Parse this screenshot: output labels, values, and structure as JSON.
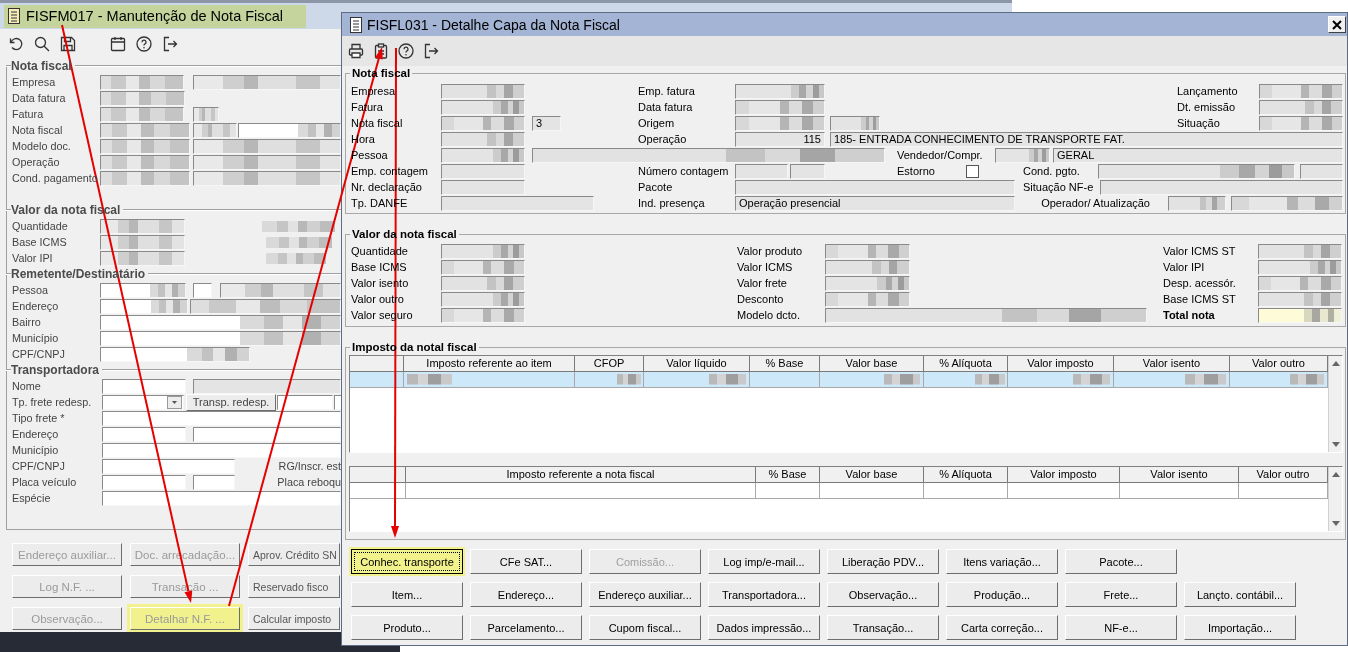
{
  "back_window": {
    "title": "FISFM017 - Manutenção de Nota Fiscal",
    "title_highlighted": true,
    "sections": [
      {
        "title": "Nota fiscal",
        "rows": [
          {
            "items": [
              {
                "kind": "label",
                "text": "Empresa"
              },
              {
                "kind": "redacted"
              },
              {
                "kind": "redacted"
              }
            ]
          },
          {
            "items": [
              {
                "kind": "label",
                "text": "Data fatura"
              },
              {
                "kind": "redacted"
              }
            ]
          },
          {
            "items": [
              {
                "kind": "label",
                "text": "Fatura"
              },
              {
                "kind": "redacted"
              },
              {
                "kind": "redacted"
              }
            ]
          },
          {
            "items": [
              {
                "kind": "label",
                "text": "Nota fiscal"
              },
              {
                "kind": "redacted"
              },
              {
                "kind": "redacted"
              },
              {
                "kind": "redacted"
              }
            ]
          },
          {
            "items": [
              {
                "kind": "label",
                "text": "Modelo doc."
              },
              {
                "kind": "redacted"
              },
              {
                "kind": "redacted"
              }
            ]
          },
          {
            "items": [
              {
                "kind": "label",
                "text": "Operação"
              },
              {
                "kind": "redacted"
              },
              {
                "kind": "redacted"
              }
            ]
          },
          {
            "items": [
              {
                "kind": "label",
                "text": "Cond. pagamento"
              },
              {
                "kind": "redacted"
              },
              {
                "kind": "redacted"
              }
            ]
          }
        ]
      },
      {
        "title": "Valor da nota fiscal",
        "rows": [
          {
            "items": [
              {
                "kind": "label",
                "text": "Quantidade"
              },
              {
                "kind": "redacted"
              },
              {
                "kind": "blot"
              }
            ]
          },
          {
            "items": [
              {
                "kind": "label",
                "text": "Base ICMS"
              },
              {
                "kind": "redacted"
              },
              {
                "kind": "blot"
              }
            ]
          },
          {
            "items": [
              {
                "kind": "label",
                "text": "Valor IPI"
              },
              {
                "kind": "redacted"
              },
              {
                "kind": "blot"
              }
            ]
          }
        ]
      },
      {
        "title": "Remetente/Destinatário",
        "rows": [
          {
            "items": [
              {
                "kind": "label",
                "text": "Pessoa"
              },
              {
                "kind": "redacted"
              },
              {
                "kind": "field"
              },
              {
                "kind": "redacted"
              }
            ]
          },
          {
            "items": [
              {
                "kind": "label",
                "text": "Endereço"
              },
              {
                "kind": "redacted"
              },
              {
                "kind": "redacted"
              }
            ]
          },
          {
            "items": [
              {
                "kind": "label",
                "text": "Bairro"
              },
              {
                "kind": "redacted"
              }
            ]
          },
          {
            "items": [
              {
                "kind": "label",
                "text": "Município"
              },
              {
                "kind": "redacted"
              }
            ]
          },
          {
            "items": [
              {
                "kind": "label",
                "text": "CPF/CNPJ"
              },
              {
                "kind": "redacted"
              }
            ]
          }
        ]
      },
      {
        "title": "Transportadora",
        "rows": [
          {
            "items": [
              {
                "kind": "label",
                "text": "Nome"
              },
              {
                "kind": "field"
              },
              {
                "kind": "readonly"
              }
            ]
          },
          {
            "items": [
              {
                "kind": "label",
                "text": "Tp. frete redesp."
              },
              {
                "kind": "dropdown"
              },
              {
                "kind": "button",
                "text": "Transp. redesp."
              },
              {
                "kind": "field"
              },
              {
                "kind": "field"
              }
            ]
          },
          {
            "items": [
              {
                "kind": "label",
                "text": "Tipo frete *"
              },
              {
                "kind": "field"
              }
            ]
          },
          {
            "items": [
              {
                "kind": "label",
                "text": "Endereço"
              },
              {
                "kind": "field"
              },
              {
                "kind": "field"
              }
            ]
          },
          {
            "items": [
              {
                "kind": "label",
                "text": "Município"
              },
              {
                "kind": "field"
              }
            ]
          },
          {
            "items": [
              {
                "kind": "label",
                "text": "CPF/CNPJ"
              },
              {
                "kind": "field"
              },
              {
                "kind": "label",
                "text": "RG/Inscr. est"
              }
            ]
          },
          {
            "items": [
              {
                "kind": "label",
                "text": "Placa veículo"
              },
              {
                "kind": "field"
              },
              {
                "kind": "field"
              },
              {
                "kind": "label",
                "text": "Placa reboqu"
              }
            ]
          },
          {
            "items": [
              {
                "kind": "label",
                "text": "Espécie"
              },
              {
                "kind": "field"
              }
            ]
          }
        ]
      }
    ],
    "buttons": [
      {
        "label": "Endereço auxiliar...",
        "disabled": true,
        "highlighted": false
      },
      {
        "label": "Doc. arrecadação...",
        "disabled": true,
        "highlighted": false
      },
      {
        "label": "Aprov. Crédito SN",
        "disabled": false,
        "highlighted": false
      },
      {
        "label": "Log N.F. ...",
        "disabled": true,
        "highlighted": false
      },
      {
        "label": "Transação ...",
        "disabled": true,
        "highlighted": false
      },
      {
        "label": "Reservado fisco",
        "disabled": false,
        "highlighted": false
      },
      {
        "label": "Observação...",
        "disabled": true,
        "highlighted": false
      },
      {
        "label": "Detalhar N.F. ...",
        "disabled": true,
        "highlighted": true
      },
      {
        "label": "Calcular imposto",
        "disabled": false,
        "highlighted": false
      }
    ]
  },
  "dialog": {
    "title": "FISFL031 - Detalhe Capa da Nota Fiscal",
    "groups": [
      {
        "title": "Nota fiscal",
        "rows": [
          {
            "items": [
              {
                "kind": "label",
                "text": "Empresa"
              },
              {
                "kind": "redacted"
              },
              {
                "kind": "label",
                "text": "Emp. fatura"
              },
              {
                "kind": "redacted"
              },
              {
                "kind": "label",
                "text": "Lançamento"
              },
              {
                "kind": "redacted"
              }
            ]
          },
          {
            "items": [
              {
                "kind": "label",
                "text": "Fatura"
              },
              {
                "kind": "redacted"
              },
              {
                "kind": "label",
                "text": "Data fatura"
              },
              {
                "kind": "redacted"
              },
              {
                "kind": "label",
                "text": "Dt. emissão"
              },
              {
                "kind": "redacted"
              }
            ]
          },
          {
            "items": [
              {
                "kind": "label",
                "text": "Nota fiscal"
              },
              {
                "kind": "redacted"
              },
              {
                "kind": "readonly",
                "value": "3"
              },
              {
                "kind": "label",
                "text": "Origem"
              },
              {
                "kind": "redacted"
              },
              {
                "kind": "redacted"
              },
              {
                "kind": "label",
                "text": "Situação"
              },
              {
                "kind": "redacted"
              }
            ]
          },
          {
            "items": [
              {
                "kind": "label",
                "text": "Hora"
              },
              {
                "kind": "redacted"
              },
              {
                "kind": "label",
                "text": "Operação"
              },
              {
                "kind": "readonly",
                "value": "115"
              },
              {
                "kind": "readonly",
                "value": "185- ENTRADA CONHECIMENTO DE TRANSPORTE FAT."
              }
            ]
          },
          {
            "items": [
              {
                "kind": "label",
                "text": "Pessoa"
              },
              {
                "kind": "redacted"
              },
              {
                "kind": "redacted"
              },
              {
                "kind": "label",
                "text": "Vendedor/Compr."
              },
              {
                "kind": "redacted"
              },
              {
                "kind": "readonly",
                "value": "GERAL"
              }
            ]
          },
          {
            "items": [
              {
                "kind": "label",
                "text": "Emp. contagem"
              },
              {
                "kind": "readonly"
              },
              {
                "kind": "label",
                "text": "Número contagem"
              },
              {
                "kind": "readonly"
              },
              {
                "kind": "readonly"
              },
              {
                "kind": "label",
                "text": "Estorno"
              },
              {
                "kind": "checkbox",
                "checked": false
              },
              {
                "kind": "label",
                "text": "Cond. pgto."
              },
              {
                "kind": "redacted"
              },
              {
                "kind": "readonly"
              }
            ]
          },
          {
            "items": [
              {
                "kind": "label",
                "text": "Nr. declaração"
              },
              {
                "kind": "readonly"
              },
              {
                "kind": "label",
                "text": "Pacote"
              },
              {
                "kind": "readonly"
              },
              {
                "kind": "label",
                "text": "Situação NF-e"
              },
              {
                "kind": "readonly"
              }
            ]
          },
          {
            "items": [
              {
                "kind": "label",
                "text": "Tp. DANFE"
              },
              {
                "kind": "readonly"
              },
              {
                "kind": "label",
                "text": "Ind. presença"
              },
              {
                "kind": "readonly",
                "value": "Operação presencial"
              },
              {
                "kind": "label",
                "text": "Operador/ Atualização"
              },
              {
                "kind": "redacted"
              },
              {
                "kind": "redacted"
              }
            ]
          }
        ]
      },
      {
        "title": "Valor da nota fiscal",
        "rows": [
          {
            "items": [
              {
                "kind": "label",
                "text": "Quantidade"
              },
              {
                "kind": "redacted"
              },
              {
                "kind": "label",
                "text": "Valor produto"
              },
              {
                "kind": "redacted"
              },
              {
                "kind": "label",
                "text": "Valor ICMS ST"
              },
              {
                "kind": "redacted"
              }
            ]
          },
          {
            "items": [
              {
                "kind": "label",
                "text": "Base ICMS"
              },
              {
                "kind": "redacted"
              },
              {
                "kind": "label",
                "text": "Valor ICMS"
              },
              {
                "kind": "redacted"
              },
              {
                "kind": "label",
                "text": "Valor IPI"
              },
              {
                "kind": "redacted"
              }
            ]
          },
          {
            "items": [
              {
                "kind": "label",
                "text": "Valor isento"
              },
              {
                "kind": "redacted"
              },
              {
                "kind": "label",
                "text": "Valor frete"
              },
              {
                "kind": "redacted"
              },
              {
                "kind": "label",
                "text": "Desp. acessór."
              },
              {
                "kind": "redacted"
              }
            ]
          },
          {
            "items": [
              {
                "kind": "label",
                "text": "Valor outro"
              },
              {
                "kind": "redacted"
              },
              {
                "kind": "label",
                "text": "Desconto"
              },
              {
                "kind": "redacted"
              },
              {
                "kind": "label",
                "text": "Base ICMS ST"
              },
              {
                "kind": "redacted"
              }
            ]
          },
          {
            "items": [
              {
                "kind": "label",
                "text": "Valor seguro"
              },
              {
                "kind": "redacted"
              },
              {
                "kind": "label",
                "text": "Modelo dcto."
              },
              {
                "kind": "redacted"
              },
              {
                "kind": "strong-label",
                "text": "Total nota"
              },
              {
                "kind": "total"
              }
            ]
          }
        ]
      }
    ],
    "tax_group": {
      "title": "Imposto da notal fiscal",
      "tables": [
        {
          "columns": [
            {
              "label": "Imposto referente ao item"
            },
            {
              "label": "CFOP"
            },
            {
              "label": "Valor líquido"
            },
            {
              "label": "% Base"
            },
            {
              "label": "Valor base"
            },
            {
              "label": "% Alíquota"
            },
            {
              "label": "Valor imposto"
            },
            {
              "label": "Valor isento"
            },
            {
              "label": "Valor outro"
            }
          ],
          "rows": [
            {
              "selected": true,
              "cells": [
                {
                  "redacted": true
                },
                {
                  "redacted": true
                },
                {
                  "redacted": true
                },
                {
                  "redacted": false
                },
                {
                  "redacted": true
                },
                {
                  "redacted": true
                },
                {
                  "redacted": true
                },
                {
                  "redacted": true
                },
                {
                  "redacted": true
                }
              ]
            }
          ]
        },
        {
          "columns": [
            {
              "label": "Imposto referente a nota fiscal"
            },
            {
              "label": "% Base"
            },
            {
              "label": "Valor base"
            },
            {
              "label": "% Alíquota"
            },
            {
              "label": "Valor imposto"
            },
            {
              "label": "Valor isento"
            },
            {
              "label": "Valor outro"
            }
          ],
          "rows": [
            {
              "selected": false,
              "cells": [
                {
                  "redacted": false
                },
                {
                  "redacted": false
                },
                {
                  "redacted": false
                },
                {
                  "redacted": false
                },
                {
                  "redacted": false
                },
                {
                  "redacted": false
                },
                {
                  "redacted": false
                }
              ]
            }
          ]
        }
      ]
    },
    "button_rows": [
      {
        "buttons": [
          {
            "label": "Conhec. transporte",
            "highlighted": true,
            "focused": true,
            "disabled": false
          },
          {
            "label": "CFe SAT...",
            "highlighted": false,
            "focused": false,
            "disabled": false
          },
          {
            "label": "Comissão...",
            "highlighted": false,
            "focused": false,
            "disabled": true
          },
          {
            "label": "Log imp/e-mail...",
            "highlighted": false,
            "focused": false,
            "disabled": false
          },
          {
            "label": "Liberação PDV...",
            "highlighted": false,
            "focused": false,
            "disabled": false
          },
          {
            "label": "Itens variação...",
            "highlighted": false,
            "focused": false,
            "disabled": false
          },
          {
            "label": "Pacote...",
            "highlighted": false,
            "focused": false,
            "disabled": false
          }
        ]
      },
      {
        "buttons": [
          {
            "label": "Item...",
            "highlighted": false,
            "focused": false,
            "disabled": false
          },
          {
            "label": "Endereço...",
            "highlighted": false,
            "focused": false,
            "disabled": false
          },
          {
            "label": "Endereço auxiliar...",
            "highlighted": false,
            "focused": false,
            "disabled": false
          },
          {
            "label": "Transportadora...",
            "highlighted": false,
            "focused": false,
            "disabled": false
          },
          {
            "label": "Observação...",
            "highlighted": false,
            "focused": false,
            "disabled": false
          },
          {
            "label": "Produção...",
            "highlighted": false,
            "focused": false,
            "disabled": false
          },
          {
            "label": "Frete...",
            "highlighted": false,
            "focused": false,
            "disabled": false
          },
          {
            "label": "Lançto. contábil...",
            "highlighted": false,
            "focused": false,
            "disabled": false
          }
        ]
      },
      {
        "buttons": [
          {
            "label": "Produto...",
            "highlighted": false,
            "focused": false,
            "disabled": false
          },
          {
            "label": "Parcelamento...",
            "highlighted": false,
            "focused": false,
            "disabled": false
          },
          {
            "label": "Cupom fiscal...",
            "highlighted": false,
            "focused": false,
            "disabled": false
          },
          {
            "label": "Dados impressão...",
            "highlighted": false,
            "focused": false,
            "disabled": false
          },
          {
            "label": "Transação...",
            "highlighted": false,
            "focused": false,
            "disabled": false
          },
          {
            "label": "Carta correção...",
            "highlighted": false,
            "focused": false,
            "disabled": false
          },
          {
            "label": "NF-e...",
            "highlighted": false,
            "focused": false,
            "disabled": false
          },
          {
            "label": "Importação...",
            "highlighted": false,
            "focused": false,
            "disabled": false
          }
        ]
      }
    ]
  }
}
